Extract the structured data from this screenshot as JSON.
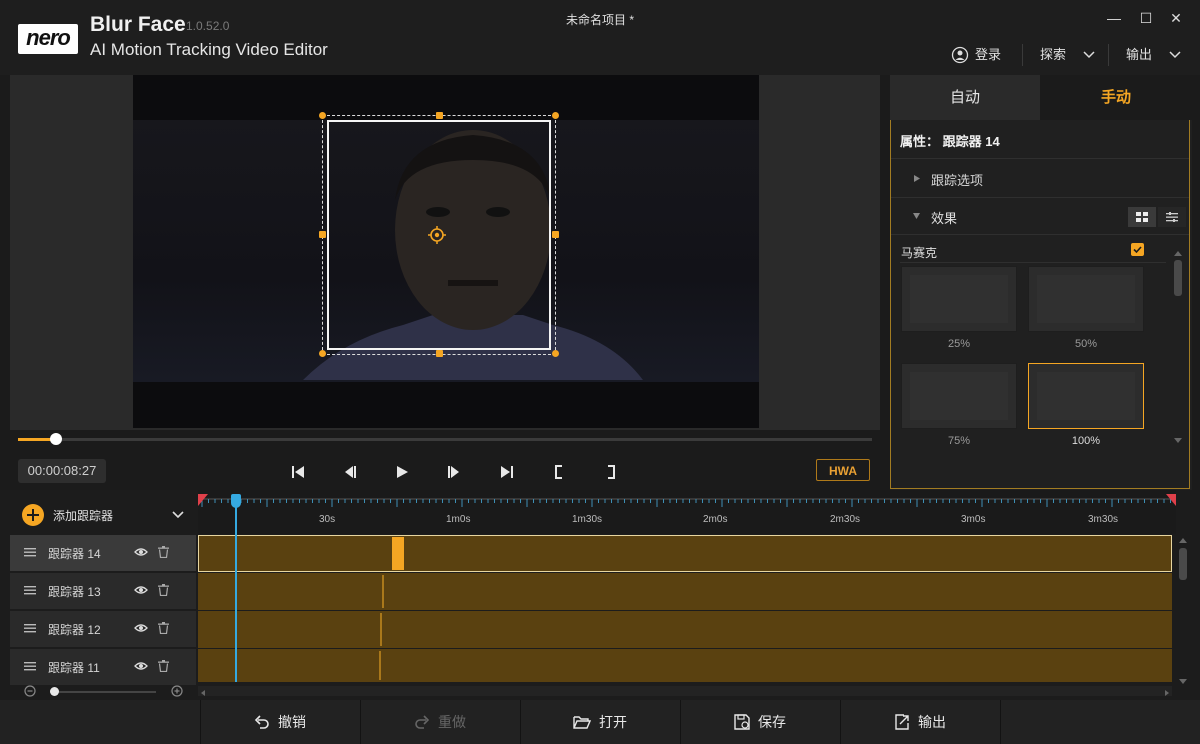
{
  "app": {
    "logo": "nero",
    "name": "Blur Face",
    "version": "1.0.52.0",
    "subtitle": "AI Motion Tracking Video Editor",
    "project_title": "未命名项目 *"
  },
  "window_controls": {
    "minimize": "—",
    "maximize": "☐",
    "close": "✕"
  },
  "top_actions": {
    "login": "登录",
    "explore": "探索",
    "export": "输出"
  },
  "player": {
    "timecode": "00:00:08:27",
    "progress": 0.045,
    "hwa_label": "HWA"
  },
  "panel": {
    "tabs": [
      "自动",
      "手动"
    ],
    "active_tab": "手动",
    "property_title": "属性： 跟踪器 14",
    "sections": {
      "tracking_options": "跟踪选项",
      "effects": "效果"
    },
    "mosaic_label": "马赛克",
    "mosaic_enabled": true,
    "thumbnails": [
      "25%",
      "50%",
      "75%",
      "100%"
    ],
    "selected_thumbnail": "100%"
  },
  "timeline": {
    "add_tracker": "添加跟踪器",
    "ticks": [
      "30s",
      "1m0s",
      "1m30s",
      "2m0s",
      "2m30s",
      "3m0s",
      "3m30s"
    ],
    "tracks": [
      {
        "name": "跟踪器 14",
        "selected": true
      },
      {
        "name": "跟踪器 13",
        "selected": false
      },
      {
        "name": "跟踪器 12",
        "selected": false
      },
      {
        "name": "跟踪器 11",
        "selected": false
      }
    ]
  },
  "bottom_bar": {
    "undo": "撤销",
    "redo": "重做",
    "open": "打开",
    "save": "保存",
    "output": "输出"
  },
  "colors": {
    "accent": "#f5a623",
    "playhead": "#35a9e0",
    "lane": "#5a4110"
  }
}
